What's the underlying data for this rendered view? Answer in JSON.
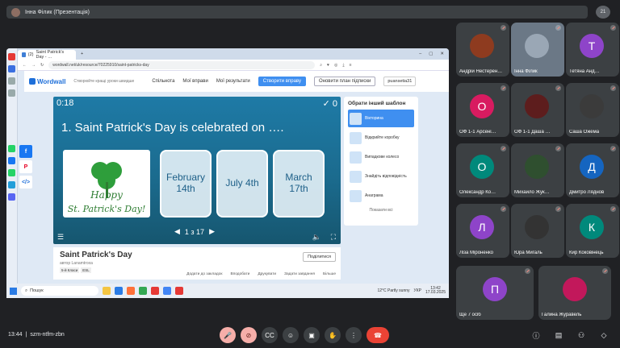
{
  "meet": {
    "presenter_label": "Інна Філик (Презентація)",
    "participant_count_badge": "21",
    "meeting_time": "13:44",
    "meeting_code": "szm-ntfm-zbn"
  },
  "browser": {
    "tab_title": "Saint Patrick's Day - …",
    "tab_count": "(2)",
    "url": "wordwall.net/uk/resource/70225910/saint-patricks-day"
  },
  "wordwall": {
    "logo": "Wordwall",
    "tagline": "Створюйте кращі уроки швидше",
    "nav": [
      "Спільнота",
      "Мої вправи",
      "Мої результати"
    ],
    "create_button": "Створити вправу",
    "upgrade_button": "Оновити план підписки",
    "username": "puansetia31"
  },
  "game": {
    "timer": "0:18",
    "score": "0",
    "question": "1. Saint Patrick's Day is celebrated on ….",
    "answers": [
      "February 14th",
      "July 4th",
      "March 17th"
    ],
    "image_text": [
      "Happy",
      "St. Patrick's Day!"
    ],
    "page_indicator": "1 з 17"
  },
  "template_panel": {
    "title": "Обрати інший шаблон",
    "items": [
      "Вікторина",
      "Відкрийте коробку",
      "Випадкове колесо",
      "Знайдіть відповідність",
      "Анаграма"
    ],
    "show_all": "Показати всі"
  },
  "resource": {
    "title": "Saint Patrick's Day",
    "author_label": "автор",
    "author": "Lanamtroxa",
    "levels": [
      "5-й Класи",
      "ESL"
    ],
    "share_button": "Поділитися",
    "actions": [
      "Додати до закладок",
      "Вподобати",
      "Друкувати",
      "Задати завдання",
      "Більше"
    ]
  },
  "taskbar": {
    "search": "Пошук",
    "weather": "12°C Partly sunny",
    "lang": "УКР",
    "time": "13:42",
    "date": "17.03.2025"
  },
  "participants": [
    {
      "name": "Андрій Нестерен…",
      "letter": "",
      "color": "#8e3b1f"
    },
    {
      "name": "Інна Філик",
      "letter": "",
      "color": "#9aa7b5"
    },
    {
      "name": "Тетяна Анд…",
      "letter": "Т",
      "color": "#8e44c9"
    },
    {
      "name": "ОФ 1-1 Арсені…",
      "letter": "О",
      "color": "#d81b60"
    },
    {
      "name": "ОФ 1-1 Даша …",
      "letter": "",
      "color": "#5d1d1d"
    },
    {
      "name": "Саша Ожема",
      "letter": "",
      "color": "#3b3b3b"
    },
    {
      "name": "Олександр Ко…",
      "letter": "О",
      "color": "#00897b"
    },
    {
      "name": "Михайло Жук…",
      "letter": "",
      "color": "#2f4f2f"
    },
    {
      "name": "Дмитро Ляднов",
      "letter": "Д",
      "color": "#1565c0"
    },
    {
      "name": "Ліза Міроненко",
      "letter": "Л",
      "color": "#8e44c9"
    },
    {
      "name": "Юра Мигаль",
      "letter": "",
      "color": "#333333"
    },
    {
      "name": "Кир Коковінець",
      "letter": "К",
      "color": "#00897b"
    },
    {
      "name": "Ще 7 осіб",
      "letter": "П",
      "color": "#8e44c9"
    },
    {
      "name": "Галина Журавель",
      "letter": "",
      "color": "#c2185b"
    }
  ]
}
